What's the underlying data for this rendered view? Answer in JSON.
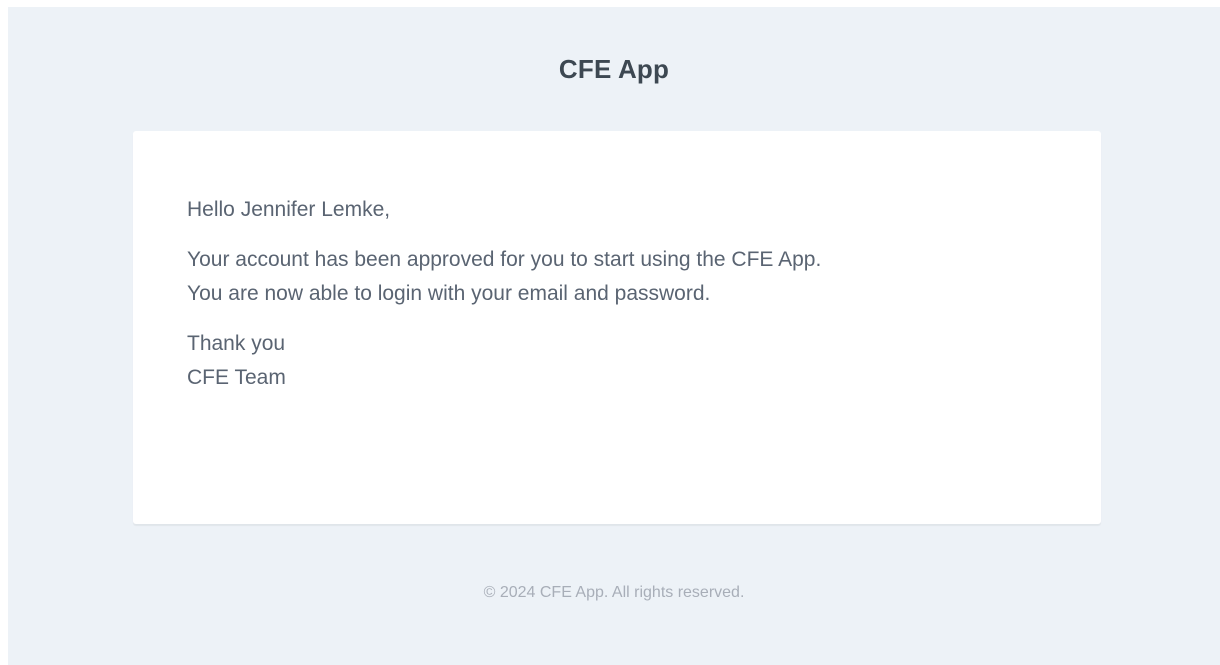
{
  "header": {
    "app_name": "CFE App"
  },
  "body": {
    "greeting": "Hello Jennifer Lemke,",
    "message_line_1": "Your account has been approved for you to start using the CFE App.",
    "message_line_2": "You are now able to login with your email and password.",
    "signoff_line_1": "Thank you",
    "signoff_line_2": "CFE Team"
  },
  "footer": {
    "copyright": "© 2024 CFE App. All rights reserved."
  },
  "colors": {
    "page_background": "#edf2f7",
    "card_background": "#ffffff",
    "title_text": "#3d4852",
    "body_text": "#5a6472",
    "footer_text": "#a8aeb8"
  }
}
